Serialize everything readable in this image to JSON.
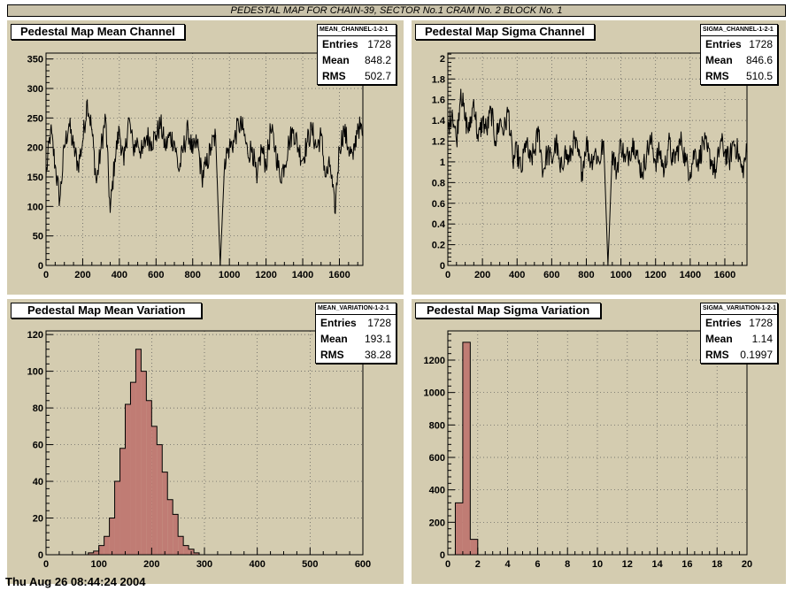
{
  "page_title": "PEDESTAL MAP FOR CHAIN-39, SECTOR No.1 CRAM No. 2 BLOCK No. 1",
  "footer_text": "Thu Aug 26 08:44:24 2004",
  "colors": {
    "pad_bg": "#d4ccb0",
    "hist_fill": "#c07c74",
    "line": "#000000",
    "grid": "#555555"
  },
  "chart_data": [
    {
      "type": "line",
      "title": "Pedestal Map Mean Channel",
      "stats": {
        "name": "MEAN_CHANNEL-1-2-1",
        "entries_label": "Entries",
        "entries": "1728",
        "mean_label": "Mean",
        "mean": "848.2",
        "rms_label": "RMS",
        "rms": "502.7"
      },
      "xlim": [
        0,
        1728
      ],
      "ylim": [
        0,
        360
      ],
      "xticks": [
        0,
        200,
        400,
        600,
        800,
        1000,
        1200,
        1400,
        1600
      ],
      "yticks": [
        0,
        50,
        100,
        150,
        200,
        250,
        300,
        350
      ],
      "grid": true,
      "x": [
        0,
        25,
        50,
        75,
        100,
        125,
        150,
        175,
        200,
        225,
        250,
        275,
        300,
        325,
        350,
        375,
        400,
        425,
        450,
        475,
        500,
        525,
        550,
        575,
        600,
        625,
        650,
        675,
        700,
        725,
        750,
        775,
        800,
        825,
        850,
        875,
        900,
        925,
        950,
        975,
        1000,
        1025,
        1050,
        1075,
        1100,
        1125,
        1150,
        1175,
        1200,
        1225,
        1250,
        1275,
        1300,
        1325,
        1350,
        1375,
        1400,
        1425,
        1450,
        1475,
        1500,
        1525,
        1550,
        1575,
        1600,
        1625,
        1650,
        1675,
        1700,
        1728
      ],
      "y": [
        150,
        230,
        170,
        110,
        200,
        240,
        200,
        170,
        210,
        280,
        230,
        140,
        200,
        250,
        90,
        180,
        230,
        170,
        250,
        200,
        210,
        190,
        220,
        210,
        220,
        240,
        200,
        220,
        210,
        160,
        200,
        230,
        190,
        210,
        150,
        170,
        200,
        220,
        0,
        180,
        200,
        210,
        240,
        230,
        190,
        200,
        140,
        200,
        170,
        230,
        200,
        150,
        170,
        210,
        230,
        200,
        180,
        210,
        230,
        200,
        220,
        150,
        170,
        90,
        200,
        230,
        200,
        180,
        240,
        220
      ]
    },
    {
      "type": "line",
      "title": "Pedestal Map Sigma Channel",
      "stats": {
        "name": "SIGMA_CHANNEL-1-2-1",
        "entries_label": "Entries",
        "entries": "1728",
        "mean_label": "Mean",
        "mean": "846.6",
        "rms_label": "RMS",
        "rms": "510.5"
      },
      "xlim": [
        0,
        1728
      ],
      "ylim": [
        0,
        2.05
      ],
      "xticks": [
        0,
        200,
        400,
        600,
        800,
        1000,
        1200,
        1400,
        1600
      ],
      "yticks": [
        0,
        0.2,
        0.4,
        0.6,
        0.8,
        1,
        1.2,
        1.4,
        1.6,
        1.8,
        2
      ],
      "grid": true,
      "x": [
        0,
        25,
        50,
        75,
        100,
        125,
        150,
        175,
        200,
        225,
        250,
        275,
        300,
        325,
        350,
        375,
        400,
        425,
        450,
        475,
        500,
        525,
        550,
        575,
        600,
        625,
        650,
        675,
        700,
        725,
        750,
        775,
        800,
        825,
        850,
        875,
        900,
        925,
        950,
        975,
        1000,
        1025,
        1050,
        1075,
        1100,
        1125,
        1150,
        1175,
        1200,
        1225,
        1250,
        1275,
        1300,
        1325,
        1350,
        1375,
        1400,
        1425,
        1450,
        1475,
        1500,
        1525,
        1550,
        1575,
        1600,
        1625,
        1650,
        1675,
        1700,
        1728
      ],
      "y": [
        1.3,
        1.5,
        1.2,
        1.7,
        1.4,
        1.3,
        1.6,
        1.2,
        1.4,
        1.3,
        1.5,
        1.2,
        1.4,
        1.3,
        1.5,
        1.0,
        1.1,
        0.9,
        1.2,
        1.0,
        1.1,
        1.3,
        0.9,
        1.1,
        1.0,
        1.2,
        0.9,
        1.1,
        1.0,
        1.2,
        1.1,
        0.9,
        1.2,
        1.0,
        1.1,
        1.0,
        1.2,
        0,
        1.1,
        0.9,
        1.2,
        1.0,
        1.1,
        1.2,
        1.0,
        0.9,
        1.1,
        1.2,
        1.0,
        1.1,
        0.9,
        1.2,
        1.0,
        1.1,
        1.2,
        1.0,
        0.9,
        1.1,
        1.0,
        1.2,
        1.1,
        1.0,
        0.9,
        1.2,
        1.1,
        1.0,
        1.2,
        1.1,
        0.9,
        1.1
      ]
    },
    {
      "type": "bar",
      "title": "Pedestal Map Mean Variation",
      "stats": {
        "name": "MEAN_VARIATION-1-2-1",
        "entries_label": "Entries",
        "entries": "1728",
        "mean_label": "Mean",
        "mean": "193.1",
        "rms_label": "RMS",
        "rms": "38.28"
      },
      "xlim": [
        0,
        600
      ],
      "ylim": [
        0,
        122
      ],
      "xticks": [
        0,
        100,
        200,
        300,
        400,
        500,
        600
      ],
      "yticks": [
        0,
        20,
        40,
        60,
        80,
        100,
        120
      ],
      "grid": true,
      "bin_edges": [
        80,
        90,
        100,
        110,
        120,
        130,
        140,
        150,
        160,
        170,
        180,
        190,
        200,
        210,
        220,
        230,
        240,
        250,
        260,
        270,
        280,
        290
      ],
      "values": [
        1,
        2,
        5,
        10,
        20,
        40,
        58,
        82,
        94,
        112,
        100,
        84,
        70,
        60,
        45,
        30,
        22,
        10,
        5,
        3,
        1
      ]
    },
    {
      "type": "bar",
      "title": "Pedestal Map Sigma Variation",
      "stats": {
        "name": "SIGMA_VARIATION-1-2-1",
        "entries_label": "Entries",
        "entries": "1728",
        "mean_label": "Mean",
        "mean": "1.14",
        "rms_label": "RMS",
        "rms": "0.1997"
      },
      "xlim": [
        0,
        20
      ],
      "ylim": [
        0,
        1380
      ],
      "xticks": [
        0,
        2,
        4,
        6,
        8,
        10,
        12,
        14,
        16,
        18,
        20
      ],
      "yticks": [
        0,
        200,
        400,
        600,
        800,
        1000,
        1200
      ],
      "grid": true,
      "bin_edges": [
        0.5,
        1.0,
        1.5,
        2.0
      ],
      "values": [
        320,
        1310,
        95
      ]
    }
  ]
}
